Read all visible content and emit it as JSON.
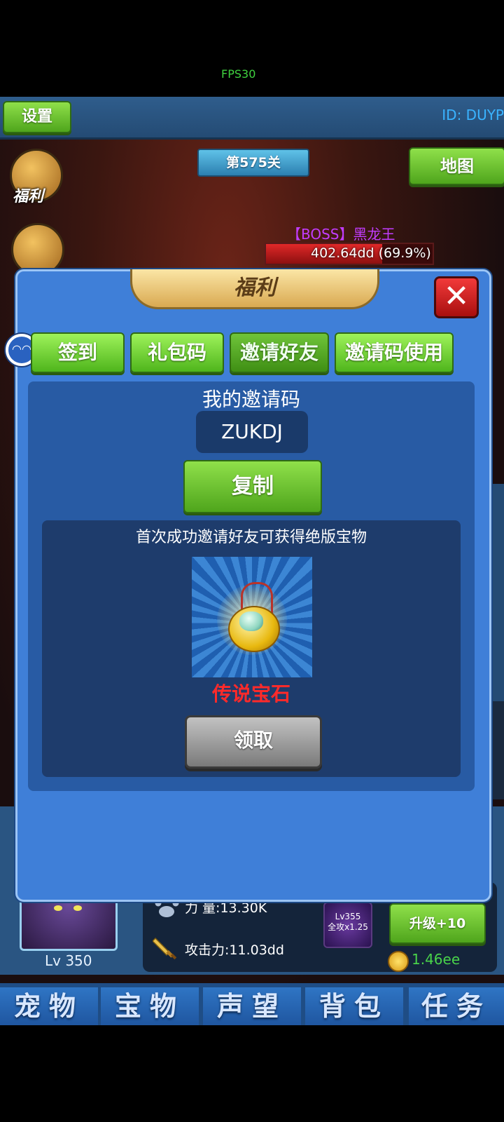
{
  "status": {
    "fps": "FPS30"
  },
  "topbar": {
    "settings_label": "设置",
    "player_id": "ID: DUYP",
    "map_label": "地图",
    "stage_label": "第575关"
  },
  "side_icons": {
    "welfare_label": "福利"
  },
  "boss": {
    "name": "【BOSS】黑龙王",
    "hp_text": "402.64dd (69.9%)",
    "hp_fraction": 0.699
  },
  "modal": {
    "title": "福利",
    "close_glyph": "✕",
    "tabs": [
      {
        "label": "签到"
      },
      {
        "label": "礼包码"
      },
      {
        "label": "邀请好友",
        "active": true
      },
      {
        "label": "邀请码使用"
      }
    ],
    "invite": {
      "title": "我的邀请码",
      "code": "ZUKDJ",
      "copy_label": "复制",
      "reward_desc": "首次成功邀请好友可获得绝版宝物",
      "reward_name": "传说宝石",
      "claim_label": "领取"
    }
  },
  "hero": {
    "level": "Lv 350",
    "power_label": "力  量:13.30K",
    "attack_label": "攻击力:11.03dd",
    "skill_level": "Lv355",
    "skill_effect": "全攻x1.25",
    "upgrade_label": "升级+10",
    "coins": "1.46ee"
  },
  "bottom_tabs": [
    {
      "label": "宠物"
    },
    {
      "label": "宝物"
    },
    {
      "label": "声望"
    },
    {
      "label": "背包"
    },
    {
      "label": "任务"
    }
  ],
  "colors": {
    "modal_bg": "#3f7fd8",
    "green_button": "#4fa51c",
    "reward_name": "#ff2a2a",
    "boss_name": "#c23cff"
  }
}
